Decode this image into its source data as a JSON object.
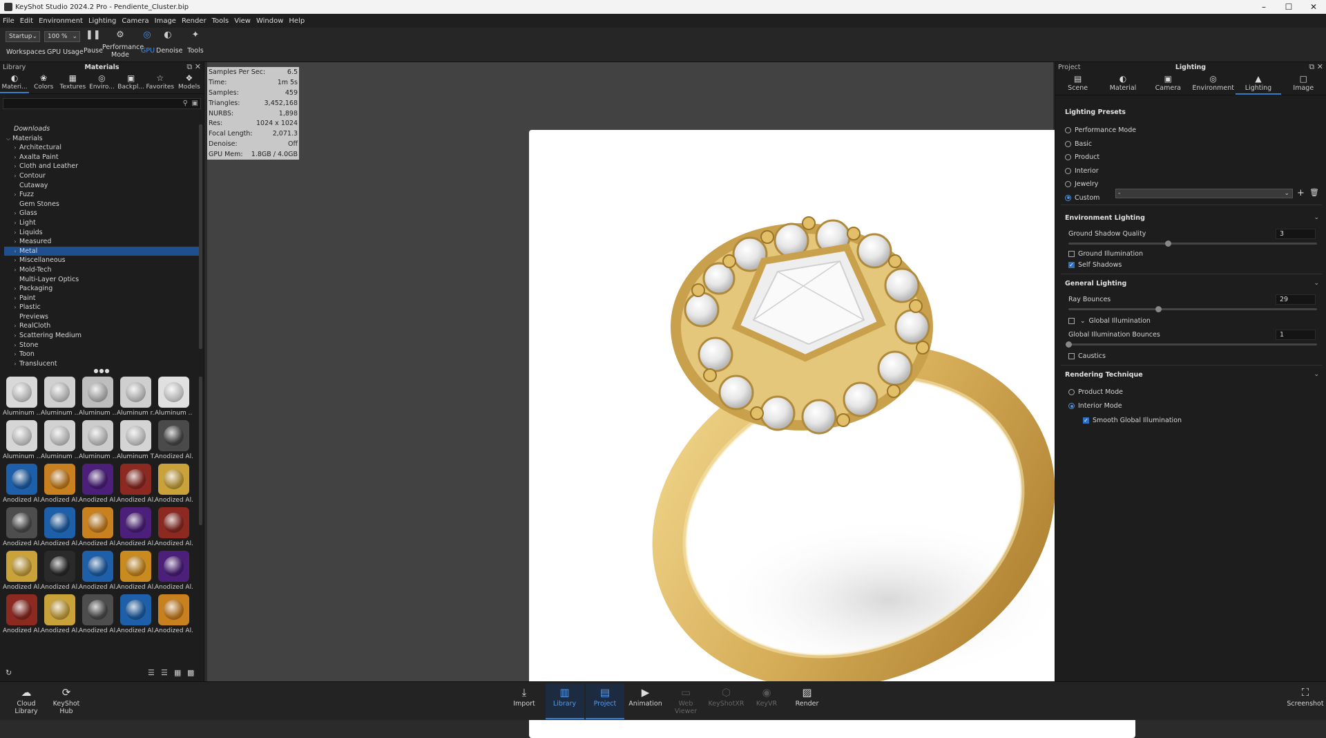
{
  "window": {
    "title": "KeyShot Studio 2024.2 Pro  - Pendiente_Cluster.bip",
    "controls": [
      "minimize",
      "maximize",
      "close"
    ]
  },
  "menu": [
    "File",
    "Edit",
    "Environment",
    "Lighting",
    "Camera",
    "Image",
    "Render",
    "Tools",
    "View",
    "Window",
    "Help"
  ],
  "toolbar": {
    "workspace_select": "Startup",
    "zoom_select": "100 %",
    "workspaces_label": "Workspaces",
    "gpu_usage_label": "GPU Usage",
    "pause_label": "Pause",
    "performance_label_1": "Performance",
    "performance_label_2": "Mode",
    "gpu_label": "GPU",
    "denoise_label": "Denoise",
    "tools_label": "Tools"
  },
  "library": {
    "panel_label": "Library",
    "panel_title": "Materials",
    "tabs": [
      {
        "label": "Materi...",
        "icon": "material-icon"
      },
      {
        "label": "Colors",
        "icon": "colors-icon"
      },
      {
        "label": "Textures",
        "icon": "textures-icon"
      },
      {
        "label": "Enviro...",
        "icon": "environment-icon"
      },
      {
        "label": "Backpl...",
        "icon": "backplate-icon"
      },
      {
        "label": "Favorites",
        "icon": "star-icon"
      },
      {
        "label": "Models",
        "icon": "models-icon"
      }
    ],
    "tree": [
      {
        "label": "Downloads",
        "indent": 0,
        "arrow": "",
        "italic": true
      },
      {
        "label": "Materials",
        "indent": 0,
        "arrow": "down"
      },
      {
        "label": "Architectural",
        "indent": 1,
        "arrow": "right"
      },
      {
        "label": "Axalta Paint",
        "indent": 1,
        "arrow": "right"
      },
      {
        "label": "Cloth and Leather",
        "indent": 1,
        "arrow": "right"
      },
      {
        "label": "Contour",
        "indent": 1,
        "arrow": "right"
      },
      {
        "label": "Cutaway",
        "indent": 1,
        "arrow": ""
      },
      {
        "label": "Fuzz",
        "indent": 1,
        "arrow": "right"
      },
      {
        "label": "Gem Stones",
        "indent": 1,
        "arrow": ""
      },
      {
        "label": "Glass",
        "indent": 1,
        "arrow": "right"
      },
      {
        "label": "Light",
        "indent": 1,
        "arrow": "right"
      },
      {
        "label": "Liquids",
        "indent": 1,
        "arrow": "right"
      },
      {
        "label": "Measured",
        "indent": 1,
        "arrow": "right"
      },
      {
        "label": "Metal",
        "indent": 1,
        "arrow": "right",
        "selected": true
      },
      {
        "label": "Miscellaneous",
        "indent": 1,
        "arrow": "right"
      },
      {
        "label": "Mold-Tech",
        "indent": 1,
        "arrow": "right"
      },
      {
        "label": "Multi-Layer Optics",
        "indent": 1,
        "arrow": ""
      },
      {
        "label": "Packaging",
        "indent": 1,
        "arrow": "right"
      },
      {
        "label": "Paint",
        "indent": 1,
        "arrow": "right"
      },
      {
        "label": "Plastic",
        "indent": 1,
        "arrow": "right"
      },
      {
        "label": "Previews",
        "indent": 1,
        "arrow": ""
      },
      {
        "label": "RealCloth",
        "indent": 1,
        "arrow": "right"
      },
      {
        "label": "Scattering Medium",
        "indent": 1,
        "arrow": "right"
      },
      {
        "label": "Stone",
        "indent": 1,
        "arrow": "right"
      },
      {
        "label": "Toon",
        "indent": 1,
        "arrow": "right"
      },
      {
        "label": "Translucent",
        "indent": 1,
        "arrow": "right"
      }
    ],
    "thumbnails": [
      {
        "label": "Aluminum ...",
        "color": "#d9d9d9"
      },
      {
        "label": "Aluminum ...",
        "color": "#d0d0d0"
      },
      {
        "label": "Aluminum ...",
        "color": "#bdbdbd"
      },
      {
        "label": "Aluminum r...",
        "color": "#cfcfcf"
      },
      {
        "label": "Aluminum ...",
        "color": "#e0e0e0"
      },
      {
        "label": "Aluminum ...",
        "color": "#d6d6d6"
      },
      {
        "label": "Aluminum ...",
        "color": "#d2d2d2"
      },
      {
        "label": "Aluminum ...",
        "color": "#cccccc"
      },
      {
        "label": "Aluminum T...",
        "color": "#d4d4d4"
      },
      {
        "label": "Anodized Al...",
        "color": "#4a4a4a"
      },
      {
        "label": "Anodized Al...",
        "color": "#1d5fa8"
      },
      {
        "label": "Anodized Al...",
        "color": "#c9801f"
      },
      {
        "label": "Anodized Al...",
        "color": "#4b1f7a"
      },
      {
        "label": "Anodized Al...",
        "color": "#8c2a22"
      },
      {
        "label": "Anodized Al...",
        "color": "#c9a23a"
      },
      {
        "label": "Anodized Al...",
        "color": "#4d4d4d"
      },
      {
        "label": "Anodized Al...",
        "color": "#1d5fa8"
      },
      {
        "label": "Anodized Al...",
        "color": "#c9801f"
      },
      {
        "label": "Anodized Al...",
        "color": "#4b1f7a"
      },
      {
        "label": "Anodized Al...",
        "color": "#8c2a22"
      },
      {
        "label": "Anodized Al...",
        "color": "#c9a23a"
      },
      {
        "label": "Anodized Al...",
        "color": "#2a2a2a"
      },
      {
        "label": "Anodized Al...",
        "color": "#1d5fa8"
      },
      {
        "label": "Anodized Al...",
        "color": "#c98a1f"
      },
      {
        "label": "Anodized Al...",
        "color": "#4b1f7a"
      },
      {
        "label": "Anodized Al...",
        "color": "#8c2a22"
      },
      {
        "label": "Anodized Al...",
        "color": "#c9a23a"
      },
      {
        "label": "Anodized Al...",
        "color": "#4d4d4d"
      },
      {
        "label": "Anodized Al...",
        "color": "#1d5fa8"
      },
      {
        "label": "Anodized Al...",
        "color": "#c9801f"
      }
    ]
  },
  "stats": [
    {
      "label": "Samples Per Sec:",
      "value": "6.5"
    },
    {
      "label": "Time:",
      "value": "1m 5s"
    },
    {
      "label": "Samples:",
      "value": "459"
    },
    {
      "label": "Triangles:",
      "value": "3,452,168"
    },
    {
      "label": "NURBS:",
      "value": "1,898"
    },
    {
      "label": "Res:",
      "value": "1024 x 1024"
    },
    {
      "label": "Focal Length:",
      "value": "2,071.3"
    },
    {
      "label": "Denoise:",
      "value": "Off"
    },
    {
      "label": "GPU Mem:",
      "value": "1.8GB / 4.0GB"
    }
  ],
  "project": {
    "panel_label": "Project",
    "panel_title": "Lighting",
    "tabs": [
      {
        "label": "Scene",
        "icon": "scene-icon"
      },
      {
        "label": "Material",
        "icon": "material-icon"
      },
      {
        "label": "Camera",
        "icon": "camera-icon"
      },
      {
        "label": "Environment",
        "icon": "environment-icon"
      },
      {
        "label": "Lighting",
        "icon": "lighting-icon",
        "active": true
      },
      {
        "label": "Image",
        "icon": "image-icon"
      }
    ],
    "lighting_presets": {
      "title": "Lighting Presets",
      "options": [
        "Performance Mode",
        "Basic",
        "Product",
        "Interior",
        "Jewelry",
        "Custom"
      ],
      "selected": "Custom",
      "custom_dropdown_value": "-"
    },
    "environment_lighting": {
      "title": "Environment Lighting",
      "ground_shadow_quality_label": "Ground Shadow Quality",
      "ground_shadow_quality_value": "3",
      "ground_shadow_quality_fraction": 0.4,
      "ground_illumination_label": "Ground Illumination",
      "ground_illumination_checked": false,
      "self_shadows_label": "Self Shadows",
      "self_shadows_checked": true
    },
    "general_lighting": {
      "title": "General Lighting",
      "ray_bounces_label": "Ray Bounces",
      "ray_bounces_value": "29",
      "ray_bounces_fraction": 0.36,
      "global_illumination_label": "Global Illumination",
      "global_illumination_checked": false,
      "gi_bounces_label": "Global Illumination Bounces",
      "gi_bounces_value": "1",
      "gi_bounces_fraction": 0.0,
      "caustics_label": "Caustics",
      "caustics_checked": false
    },
    "rendering_technique": {
      "title": "Rendering Technique",
      "options": [
        "Product Mode",
        "Interior Mode"
      ],
      "selected": "Interior Mode",
      "smooth_gi_label": "Smooth Global Illumination",
      "smooth_gi_checked": true
    }
  },
  "bottombar": {
    "cloud_library_1": "Cloud",
    "cloud_library_2": "Library",
    "keyshot_hub_1": "KeyShot",
    "keyshot_hub_2": "Hub",
    "items": [
      {
        "label": "Import",
        "icon": "import-icon",
        "state": "normal"
      },
      {
        "label": "Library",
        "icon": "library-icon",
        "state": "active"
      },
      {
        "label": "Project",
        "icon": "project-icon",
        "state": "active"
      },
      {
        "label": "Animation",
        "icon": "animation-icon",
        "state": "normal"
      },
      {
        "label": "Web Viewer",
        "icon": "web-viewer-icon",
        "state": "dim"
      },
      {
        "label": "KeyShotXR",
        "icon": "keyshotxr-icon",
        "state": "dim"
      },
      {
        "label": "KeyVR",
        "icon": "keyvr-icon",
        "state": "dim"
      },
      {
        "label": "Render",
        "icon": "render-icon",
        "state": "normal"
      }
    ],
    "screenshot_label": "Screenshot"
  },
  "colors": {
    "accent": "#2f7fd6",
    "gold": "#d9b25a",
    "panel_bg": "#1d1d1d",
    "viewport_bg": "#424242"
  }
}
